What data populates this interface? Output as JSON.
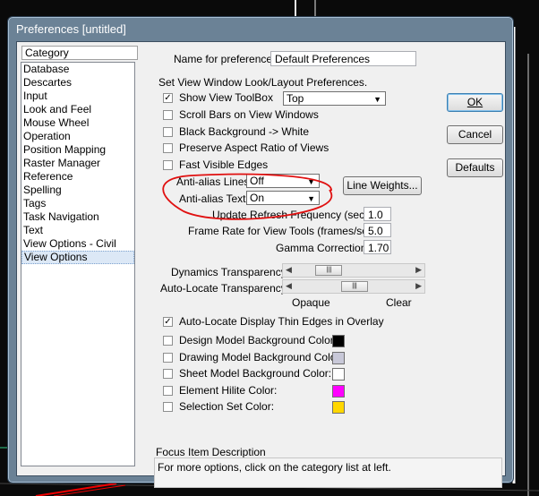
{
  "window": {
    "title": "Preferences [untitled]"
  },
  "category": {
    "header": "Category",
    "items": [
      "Database",
      "Descartes",
      "Input",
      "Look and Feel",
      "Mouse Wheel",
      "Operation",
      "Position Mapping",
      "Raster Manager",
      "Reference",
      "Spelling",
      "Tags",
      "Task Navigation",
      "Text",
      "View Options - Civil",
      "View Options"
    ],
    "selected": "View Options"
  },
  "name": {
    "label": "Name for preferences",
    "value": "Default Preferences"
  },
  "section_title": "Set View Window Look/Layout Preferences.",
  "options": {
    "show_toolbox": {
      "label": "Show View ToolBox",
      "checked": true,
      "dropdown": "Top"
    },
    "scroll_bars": {
      "label": "Scroll Bars on View Windows",
      "checked": false
    },
    "black_bg": {
      "label": "Black Background -> White",
      "checked": false
    },
    "aspect": {
      "label": "Preserve Aspect Ratio of Views",
      "checked": false
    },
    "fast_edges": {
      "label": "Fast Visible Edges",
      "checked": false
    }
  },
  "antialias_lines": {
    "label": "Anti-alias Lines:",
    "value": "Off"
  },
  "antialias_text": {
    "label": "Anti-alias Text:",
    "value": "On"
  },
  "line_weights_btn": "Line Weights...",
  "refresh": {
    "label": "Update Refresh Frequency (secs):",
    "value": "1.0"
  },
  "frame_rate": {
    "label": "Frame Rate for View Tools (frames/sec):",
    "value": "5.0"
  },
  "gamma": {
    "label": "Gamma Correction:",
    "value": "1.70"
  },
  "dynamics": {
    "label": "Dynamics Transparency:",
    "level": 0.22
  },
  "autolocate_trans": {
    "label": "Auto-Locate Transparency:",
    "level": 0.5
  },
  "opaque": "Opaque",
  "clear": "Clear",
  "thin_edges": {
    "label": "Auto-Locate Display Thin Edges in Overlay",
    "checked": true
  },
  "colors": [
    {
      "label": "Design Model Background Color:",
      "color": "#000000"
    },
    {
      "label": "Drawing Model Background Color:",
      "color": "#c8c8d8"
    },
    {
      "label": "Sheet Model Background Color:",
      "color": "#ffffff"
    },
    {
      "label": "Element Hilite Color:",
      "color": "#ff00ff"
    },
    {
      "label": "Selection Set Color:",
      "color": "#ffd700"
    }
  ],
  "focus": {
    "title": "Focus Item Description",
    "text": "For more options, click on the category list at left."
  },
  "buttons": {
    "ok": "OK",
    "cancel": "Cancel",
    "defaults": "Defaults"
  },
  "accent": {
    "annotation_red": "#e01010"
  }
}
